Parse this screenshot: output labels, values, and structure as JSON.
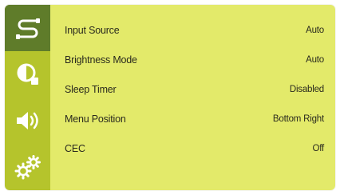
{
  "sidebar": {
    "items": [
      {
        "icon": "input-source-icon",
        "active": true
      },
      {
        "icon": "picture-icon",
        "active": false
      },
      {
        "icon": "speaker-icon",
        "active": false
      },
      {
        "icon": "gears-icon",
        "active": false
      }
    ]
  },
  "menu": {
    "rows": [
      {
        "label": "Input Source",
        "value": "Auto"
      },
      {
        "label": "Brightness Mode",
        "value": "Auto"
      },
      {
        "label": "Sleep Timer",
        "value": "Disabled"
      },
      {
        "label": "Menu Position",
        "value": "Bottom Right"
      },
      {
        "label": "CEC",
        "value": "Off"
      }
    ]
  },
  "colors": {
    "sidebar": "#b5c42c",
    "sidebar_active": "#5f7c2a",
    "content": "#e3ea6a",
    "text": "#2a2a1e",
    "icon": "#ffffff"
  }
}
